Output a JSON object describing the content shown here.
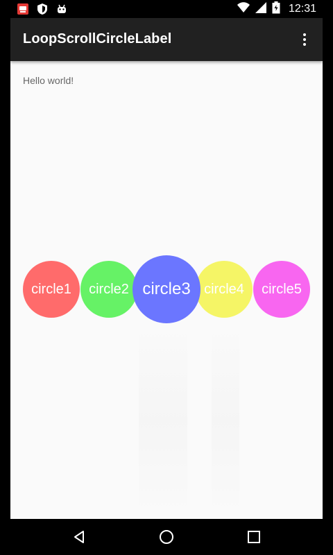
{
  "status_bar": {
    "time": "12:31",
    "notification_icons": [
      "app-notification-icon",
      "shield-icon",
      "android-icon"
    ],
    "system_icons": [
      "wifi-icon",
      "cellular-signal-icon",
      "battery-icon"
    ]
  },
  "action_bar": {
    "title": "LoopScrollCircleLabel",
    "overflow_icon": "more-vert-icon"
  },
  "content": {
    "hello_text": "Hello world!"
  },
  "circles": [
    {
      "label": "circle1",
      "color": "#ff6b6b"
    },
    {
      "label": "circle2",
      "color": "#66f266"
    },
    {
      "label": "circle3",
      "color": "#6b76ff"
    },
    {
      "label": "circle4",
      "color": "#f5f566"
    },
    {
      "label": "circle5",
      "color": "#f866f0"
    }
  ],
  "nav_bar": {
    "back_icon": "back-icon",
    "home_icon": "home-icon",
    "recents_icon": "recents-icon"
  }
}
